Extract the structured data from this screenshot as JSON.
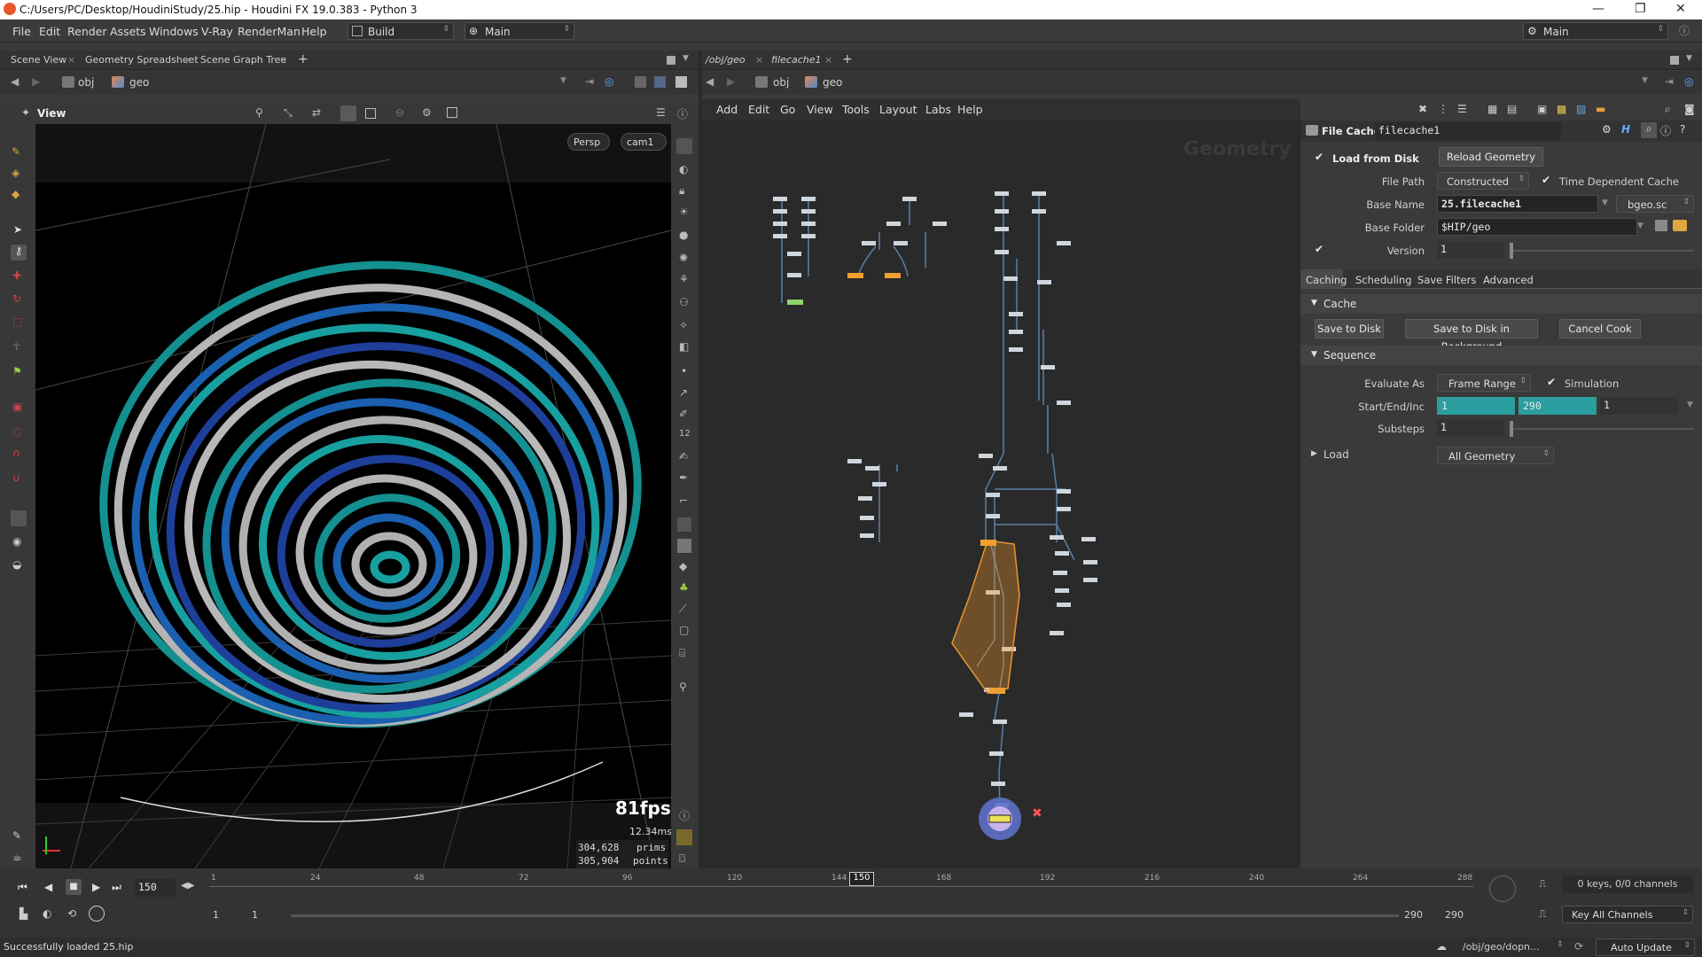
{
  "window": {
    "title": "C:/Users/PC/Desktop/HoudiniStudy/25.hip - Houdini FX 19.0.383 - Python 3"
  },
  "menubar": {
    "items": [
      "File",
      "Edit",
      "Render",
      "Assets",
      "Windows",
      "V-Ray",
      "RenderMan",
      "Help"
    ],
    "build_dd": "Build",
    "main_dd": "Main",
    "right_dd": "Main"
  },
  "left_tabs": [
    "Scene View",
    "Geometry Spreadsheet",
    "Scene Graph Tree"
  ],
  "right_tabs": [
    "/obj/geo",
    "filecache1"
  ],
  "left_path": {
    "obj": "obj",
    "geo": "geo"
  },
  "right_path": {
    "obj": "obj",
    "geo": "geo"
  },
  "viewport": {
    "title": "View",
    "persp": "Persp",
    "cam": "cam1",
    "fps": "81fps",
    "ms": "12.34ms",
    "prims_value": "304,628",
    "prims_label": "prims",
    "points_value": "305,904",
    "points_label": "points"
  },
  "network": {
    "menu": [
      "Add",
      "Edit",
      "Go",
      "View",
      "Tools",
      "Layout",
      "Labs",
      "Help"
    ],
    "watermark": "Geometry"
  },
  "params": {
    "node_type": "File Cache",
    "node_name": "filecache1",
    "load_from_disk": "Load from Disk",
    "reload": "Reload Geometry",
    "file_path_label": "File Path",
    "file_path_value": "Constructed",
    "time_dep": "Time Dependent Cache",
    "base_name_label": "Base Name",
    "base_name_value": "25.filecache1",
    "ext_value": "bgeo.sc",
    "base_folder_label": "Base Folder",
    "base_folder_value": "$HIP/geo",
    "version_label": "Version",
    "version_value": "1",
    "tabs": [
      "Caching",
      "Scheduling",
      "Save Filters",
      "Advanced"
    ],
    "cache_section": "Cache",
    "save_to_disk": "Save to Disk",
    "save_bg": "Save to Disk in Background",
    "cancel_cook": "Cancel Cook",
    "sequence_section": "Sequence",
    "evaluate_label": "Evaluate As",
    "evaluate_value": "Frame Range",
    "simulation": "Simulation",
    "sei_label": "Start/End/Inc",
    "start": "1",
    "end": "290",
    "inc": "1",
    "substeps_label": "Substeps",
    "substeps_value": "1",
    "load_section": "Load",
    "load_value": "All Geometry"
  },
  "timeline": {
    "frame": "150",
    "ticks": [
      "1",
      "24",
      "48",
      "72",
      "96",
      "120",
      "144",
      "168",
      "192",
      "216",
      "240",
      "264",
      "288"
    ],
    "marker": "150",
    "range_start": "1",
    "range_start2": "1",
    "range_end": "290",
    "range_end2": "290",
    "keys": "0 keys, 0/0 channels",
    "key_all": "Key All Channels"
  },
  "status": {
    "message": "Successfully loaded 25.hip",
    "path": "/obj/geo/dopn...",
    "update": "Auto Update"
  }
}
